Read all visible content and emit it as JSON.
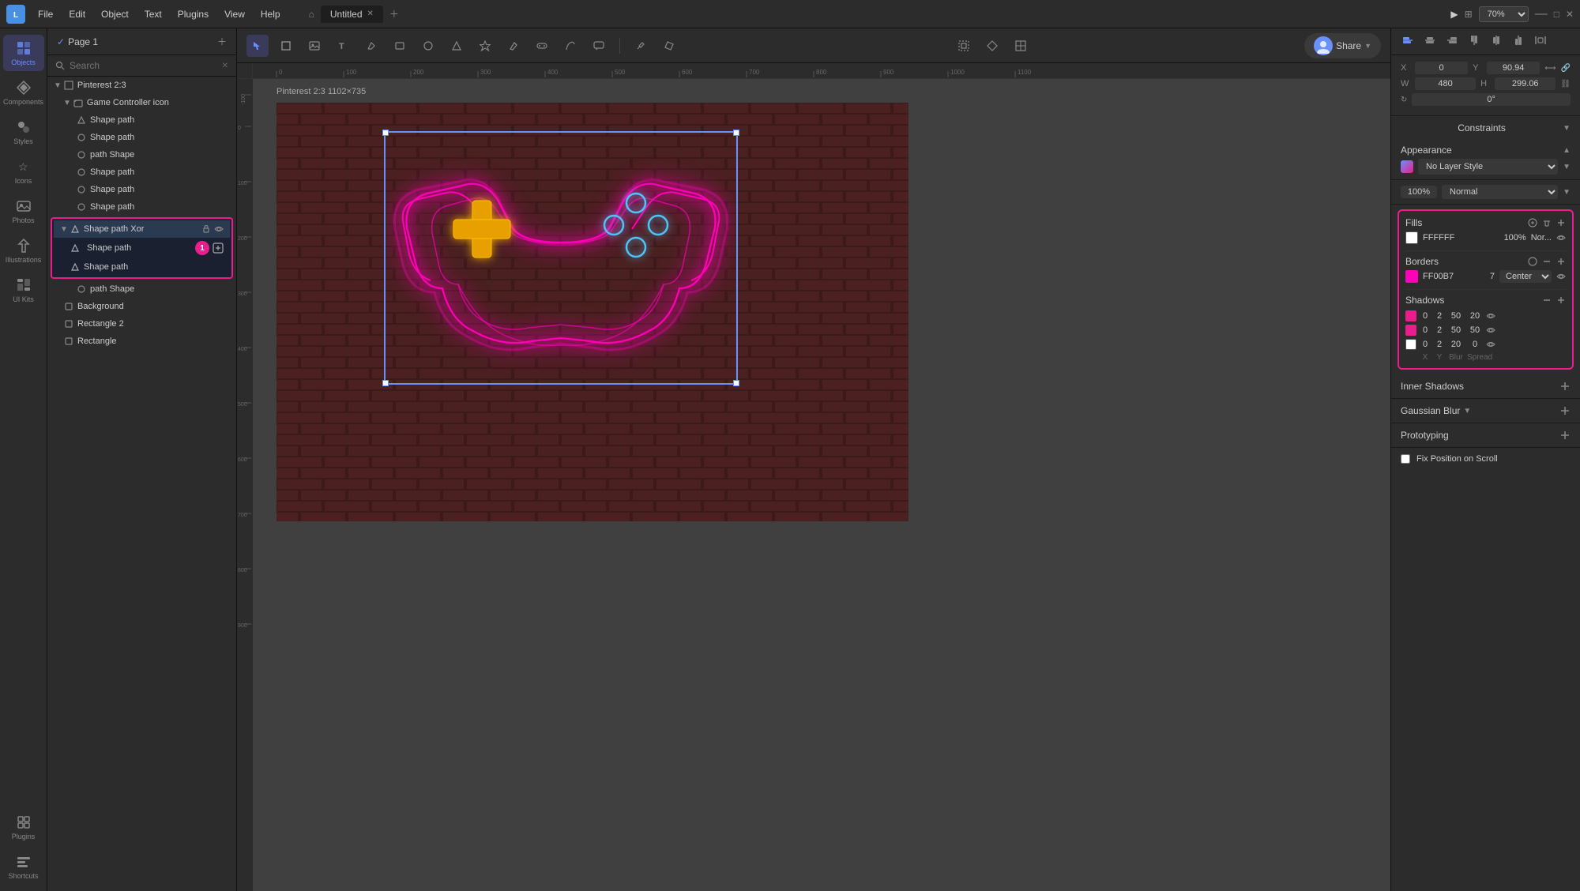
{
  "app": {
    "name": "Lunacy",
    "title": "Untitled",
    "zoom": "70%"
  },
  "menu": {
    "items": [
      "File",
      "Edit",
      "Object",
      "Text",
      "Plugins",
      "View",
      "Help"
    ]
  },
  "sidebar": {
    "icons": [
      {
        "name": "Objects",
        "id": "objects",
        "active": true
      },
      {
        "name": "Components",
        "id": "components",
        "active": false
      },
      {
        "name": "Styles",
        "id": "styles",
        "active": false
      },
      {
        "name": "Icons",
        "id": "icons",
        "active": false
      },
      {
        "name": "Photos",
        "id": "photos",
        "active": false
      },
      {
        "name": "Illustrations",
        "id": "illustrations",
        "active": false
      },
      {
        "name": "UI Kits",
        "id": "uikits",
        "active": false
      },
      {
        "name": "Plugins",
        "id": "plugins",
        "active": false
      },
      {
        "name": "Shortcuts",
        "id": "shortcuts",
        "active": false
      }
    ]
  },
  "layers": {
    "page": "Page 1",
    "search_placeholder": "Search",
    "items": [
      {
        "id": "pinterest",
        "name": "Pinterest 2:3",
        "type": "frame",
        "indent": 0,
        "expanded": true,
        "selected": false
      },
      {
        "id": "game-controller",
        "name": "Game Controller icon",
        "type": "group",
        "indent": 1,
        "expanded": true,
        "selected": false
      },
      {
        "id": "sp1",
        "name": "Shape path",
        "type": "shape",
        "indent": 2,
        "selected": false
      },
      {
        "id": "sp2",
        "name": "Shape path",
        "type": "shape",
        "indent": 2,
        "selected": false
      },
      {
        "id": "sp3",
        "name": "path Shape",
        "type": "shape",
        "indent": 2,
        "selected": false
      },
      {
        "id": "sp4",
        "name": "Shape path",
        "type": "shape",
        "indent": 2,
        "selected": false
      },
      {
        "id": "sp5",
        "name": "Shape path",
        "type": "shape",
        "indent": 2,
        "selected": false
      },
      {
        "id": "sp6",
        "name": "Shape path",
        "type": "shape",
        "indent": 2,
        "selected": false
      },
      {
        "id": "spxor",
        "name": "Shape path Xor",
        "type": "group",
        "indent": 2,
        "selected": true,
        "group_selected": true,
        "expanded": true
      },
      {
        "id": "sp7",
        "name": "Shape path",
        "type": "shape",
        "indent": 3,
        "selected": true,
        "badge": "1"
      },
      {
        "id": "sp8",
        "name": "Shape path",
        "type": "shape",
        "indent": 3,
        "selected": false
      },
      {
        "id": "sp9",
        "name": "path Shape",
        "type": "shape",
        "indent": 2,
        "selected": false
      },
      {
        "id": "background",
        "name": "Background",
        "type": "rect",
        "indent": 1,
        "selected": false
      },
      {
        "id": "rect2",
        "name": "Rectangle 2",
        "type": "rect",
        "indent": 1,
        "selected": false
      },
      {
        "id": "rect1",
        "name": "Rectangle",
        "type": "rect",
        "indent": 1,
        "selected": false
      }
    ]
  },
  "canvas": {
    "frame_label": "Pinterest 2:3  1102×735",
    "ruler_marks": [
      "0",
      "100",
      "200",
      "300",
      "400",
      "500",
      "600",
      "700",
      "800",
      "900",
      "1000",
      "1100"
    ]
  },
  "properties": {
    "x": "0",
    "y": "90.94",
    "w": "480",
    "h": "299.06",
    "rotation": "0°"
  },
  "appearance": {
    "title": "Appearance",
    "layer_style": "No Layer Style",
    "opacity": "100%",
    "blend_mode": "Normal"
  },
  "fills": {
    "title": "Fills",
    "items": [
      {
        "color": "#FFFFFF",
        "hex": "FFFFFF",
        "opacity": "100%",
        "blend": "Nor...",
        "visible": true
      }
    ]
  },
  "borders": {
    "title": "Borders",
    "items": [
      {
        "color": "#FF00B7",
        "hex": "FF00B7",
        "width": "7",
        "align": "Center",
        "visible": true
      }
    ]
  },
  "shadows": {
    "title": "Shadows",
    "col_headers": [
      "X",
      "Y",
      "Blur",
      "Spread"
    ],
    "items": [
      {
        "color": "#e91e8c",
        "x": "0",
        "y": "2",
        "blur": "50",
        "spread": "20",
        "visible": true
      },
      {
        "color": "#e91e8c",
        "x": "0",
        "y": "2",
        "blur": "50",
        "spread": "50",
        "visible": true
      },
      {
        "color": "#FFFFFF",
        "x": "0",
        "y": "2",
        "blur": "20",
        "spread": "0",
        "visible": true
      }
    ]
  },
  "inner_shadows": {
    "title": "Inner Shadows"
  },
  "gaussian_blur": {
    "title": "Gaussian Blur"
  },
  "prototyping": {
    "title": "Prototyping",
    "fix_position": "Fix Position on Scroll"
  }
}
